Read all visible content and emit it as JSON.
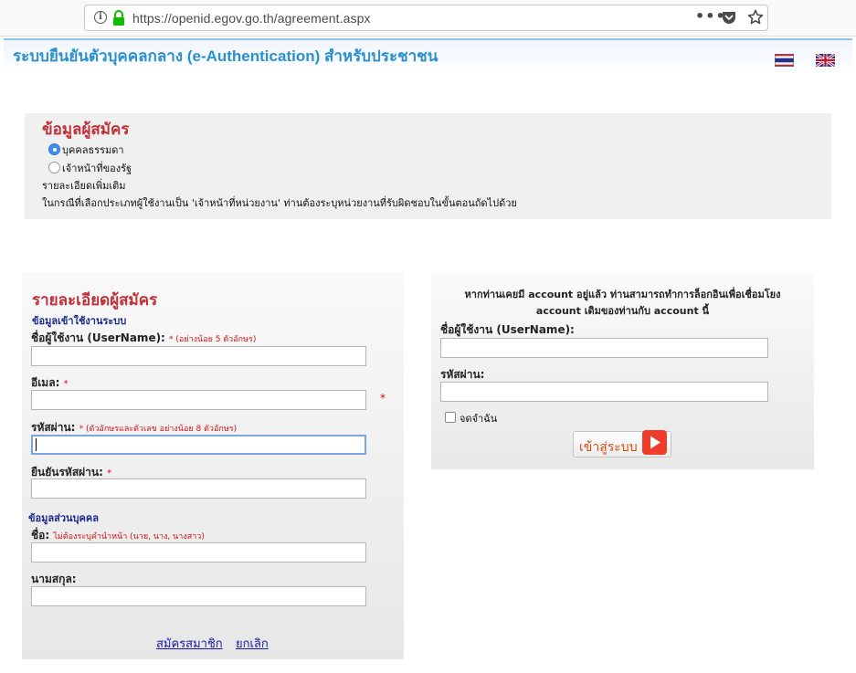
{
  "browser": {
    "url": "https://openid.egov.go.th/agreement.aspx",
    "more_label": "•••"
  },
  "header": {
    "title": "ระบบยืนยันตัวบุคคลกลาง (e-Authentication) สำหรับประชาชน"
  },
  "applicant": {
    "title": "ข้อมูลผู้สมัคร",
    "options": [
      {
        "label": "บุคคลธรรมดา",
        "selected": true
      },
      {
        "label": "เจ้าหน้าที่ของรัฐ",
        "selected": false
      }
    ],
    "details_label": "รายละเอียดเพิ่มเติม",
    "note": "ในกรณีที่เลือกประเภทผู้ใช้งานเป็น 'เจ้าหน้าที่หน่วยงาน' ท่านต้องระบุหน่วยงานที่รับผิดชอบในขั้นตอนถัดไปด้วย"
  },
  "registration": {
    "title": "รายละเอียดผู้สมัคร",
    "account_section": "ข้อมูลเข้าใช้งานระบบ",
    "username_label": "ชื่อผู้ใช้งาน (UserName):",
    "username_hint": "* (อย่างน้อย 5 ตัวอักษร)",
    "username_value": "",
    "email_label": "อีเมล:",
    "email_req": "*",
    "email_value": "",
    "email_outer_star": "*",
    "password_label": "รหัสผ่าน:",
    "password_hint": "* (ตัวอักษรและตัวเลข อย่างน้อย 8 ตัวอักษร)",
    "password_value": "",
    "confirm_label": "ยืนยันรหัสผ่าน:",
    "confirm_req": "*",
    "confirm_value": "",
    "personal_section": "ข้อมูลส่วนบุคคล",
    "firstname_label": "ชื่อ:",
    "firstname_hint": "ไม่ต้องระบุคำนำหน้า (นาย, นาง, นางสาว)",
    "firstname_value": "",
    "lastname_label": "นามสกุล:",
    "lastname_value": "",
    "register_link": "สมัครสมาชิก",
    "cancel_link": "ยกเลิก"
  },
  "login": {
    "message_line1": "หากท่านเคยมี account อยู่แล้ว ท่านสามารถทำการล็อกอินเพื่อเชื่อมโยง",
    "message_line2": "account เดิมของท่านกับ account นี้",
    "username_label": "ชื่อผู้ใช้งาน (UserName):",
    "username_value": "",
    "password_label": "รหัสผ่าน:",
    "password_value": "",
    "remember_label": "จดจำฉัน",
    "remember_checked": false,
    "button_label": "เข้าสู่ระบบ"
  },
  "colors": {
    "title_blue": "#2c8fd0",
    "section_red": "#c0313a",
    "sub_blue": "#1a2a8a",
    "link_blue": "#1a1aa8",
    "required_red": "#d01010",
    "login_orange": "#d84c12"
  },
  "icons": {
    "info": "info-icon",
    "lock": "lock-icon",
    "more": "more-icon",
    "pocket": "pocket-icon",
    "star": "bookmark-star-icon",
    "thai_flag": "thai-flag-icon",
    "uk_flag": "uk-flag-icon",
    "login_arrow": "arrow-right-icon"
  }
}
